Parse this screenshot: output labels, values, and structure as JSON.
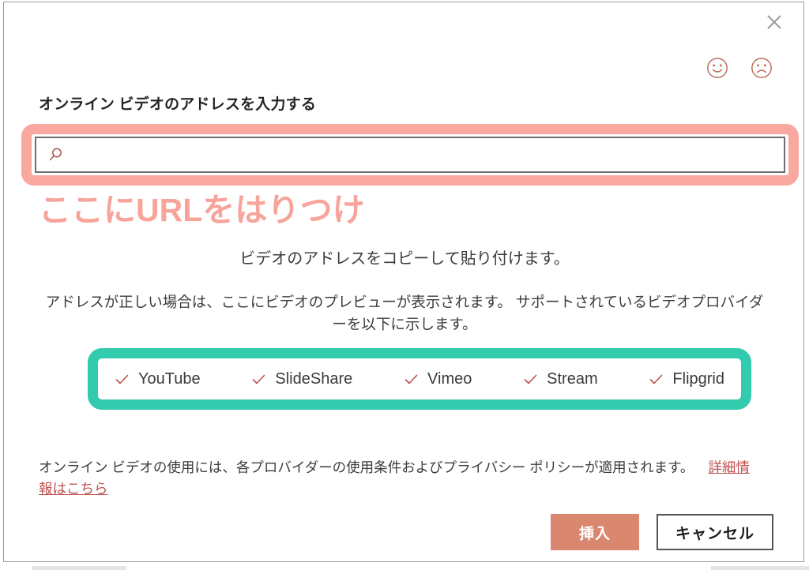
{
  "dialog": {
    "close_icon": "close-icon",
    "feedback": {
      "happy_icon": "smiley-happy-icon",
      "sad_icon": "smiley-sad-icon"
    },
    "field_label": "オンライン ビデオのアドレスを入力する",
    "search": {
      "icon": "search-icon",
      "value": "",
      "placeholder": ""
    },
    "annotation": "ここにURLをはりつけ",
    "copy_line_1": "ビデオのアドレスをコピーして貼り付けます。",
    "copy_line_2": "アドレスが正しい場合は、ここにビデオのプレビューが表示されます。 サポートされているビデオプロバイダーを以下に示します。",
    "providers": [
      {
        "check_icon": "check-icon",
        "name": "YouTube"
      },
      {
        "check_icon": "check-icon",
        "name": "SlideShare"
      },
      {
        "check_icon": "check-icon",
        "name": "Vimeo"
      },
      {
        "check_icon": "check-icon",
        "name": "Stream"
      },
      {
        "check_icon": "check-icon",
        "name": "Flipgrid"
      }
    ],
    "legal_text": "オンライン ビデオの使用には、各プロバイダーの使用条件およびプライバシー ポリシーが適用されます。",
    "legal_link": "詳細情報はこちら",
    "buttons": {
      "insert": "挿入",
      "cancel": "キャンセル"
    }
  },
  "colors": {
    "pink_highlight": "#f9a89f",
    "annotation_pink": "#f7a49b",
    "teal_highlight": "#32cbad",
    "accent_red": "#c0504d",
    "primary_button": "#d9886f",
    "dialog_border": "#9a9a9a"
  }
}
